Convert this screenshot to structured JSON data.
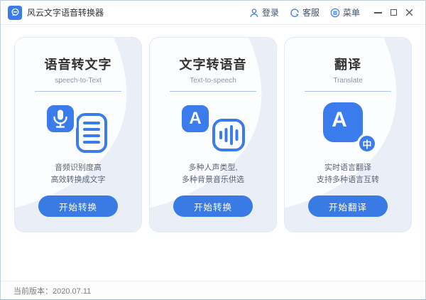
{
  "window": {
    "title": "风云文字语音转换器",
    "header_links": [
      {
        "label": "登录"
      },
      {
        "label": "客服"
      },
      {
        "label": "菜单"
      }
    ]
  },
  "cards": [
    {
      "title": "语音转文字",
      "subtitle": "speech-to-Text",
      "desc1": "音频识别度高",
      "desc2": "高效转换成文字",
      "button": "开始转换"
    },
    {
      "title": "文字转语音",
      "subtitle": "Text-to-speech",
      "desc1": "多种人声类型,",
      "desc2": "多种背景音乐供选",
      "button": "开始转换"
    },
    {
      "title": "翻译",
      "subtitle": "Translate",
      "desc1": "实时语言翻译",
      "desc2": "支持多种语言互转",
      "button": "开始翻译"
    }
  ],
  "icons": {
    "tts_letter": "A",
    "translate_letter": "A",
    "translate_badge": "中"
  },
  "footer": {
    "version": "当前版本：2020.07.11"
  },
  "colors": {
    "accent": "#3b7ced",
    "button": "#3a7ae4",
    "card_bg": "#e9eef7"
  }
}
